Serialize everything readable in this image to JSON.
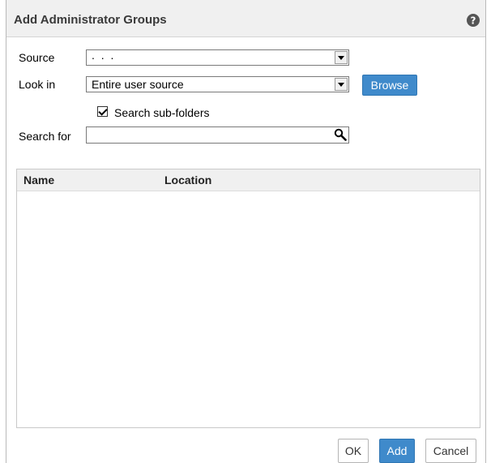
{
  "dialog": {
    "title": "Add Administrator Groups",
    "help_icon": "help-icon"
  },
  "form": {
    "source_label": "Source",
    "source_value": ". . .",
    "lookin_label": "Look in",
    "lookin_value": "Entire user source",
    "browse_label": "Browse",
    "subfolders_label": "Search sub-folders",
    "subfolders_checked": true,
    "searchfor_label": "Search for",
    "search_value": "",
    "search_icon": "search-icon"
  },
  "table": {
    "columns": [
      "Name",
      "Location"
    ],
    "rows": []
  },
  "footer": {
    "ok_label": "OK",
    "add_label": "Add",
    "cancel_label": "Cancel"
  },
  "colors": {
    "accent": "#3f8acb",
    "titlebar": "#f0f0f0",
    "border": "#7a7a7a"
  }
}
